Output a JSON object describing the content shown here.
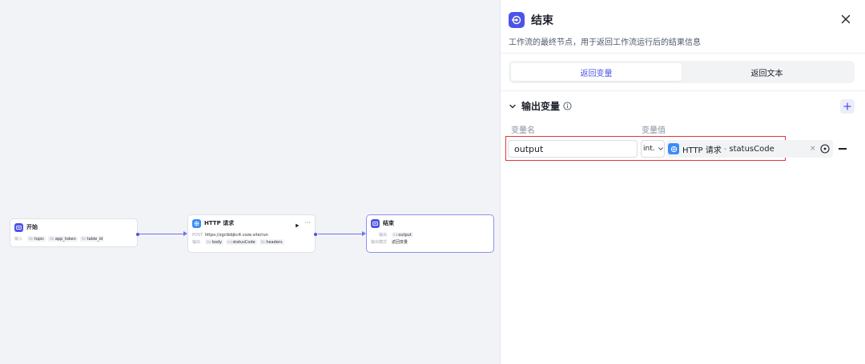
{
  "canvas": {
    "nodes": [
      {
        "id": "start",
        "title": "开始",
        "rows": [
          {
            "key": "输入",
            "tags": [
              {
                "type": "Str",
                "name": "topic"
              },
              {
                "type": "Str",
                "name": "app_token"
              },
              {
                "type": "Str",
                "name": "table_id"
              }
            ]
          }
        ]
      },
      {
        "id": "http",
        "title": "HTTP 请求",
        "rows": [
          {
            "key": "POST",
            "text": "https://zgctbbjkc4.coze.site/run"
          },
          {
            "key": "输出",
            "tags": [
              {
                "type": "Str",
                "name": "body"
              },
              {
                "type": "Int",
                "name": "statusCode"
              },
              {
                "type": "Str",
                "name": "headers"
              }
            ]
          }
        ]
      },
      {
        "id": "end",
        "title": "结束",
        "rows": [
          {
            "key": "输出",
            "tags": [
              {
                "type": "Int",
                "name": "output"
              }
            ]
          },
          {
            "key": "输出模式",
            "text": "返回变量"
          }
        ]
      }
    ]
  },
  "panel": {
    "title": "结束",
    "description": "工作流的最终节点，用于返回工作流运行后的结果信息",
    "tabs": [
      {
        "label": "返回变量",
        "active": true
      },
      {
        "label": "返回文本",
        "active": false
      }
    ],
    "section_title": "输出变量",
    "col_name": "变量名",
    "col_value": "变量值",
    "row": {
      "name": "output",
      "type": "int.",
      "ref_node": "HTTP 请求",
      "ref_sep": "-",
      "ref_field": "statusCode",
      "clear": "×"
    }
  },
  "colors": {
    "accent": "#4d53e8",
    "http": "#3a8df5",
    "highlight": "#e0363c"
  }
}
